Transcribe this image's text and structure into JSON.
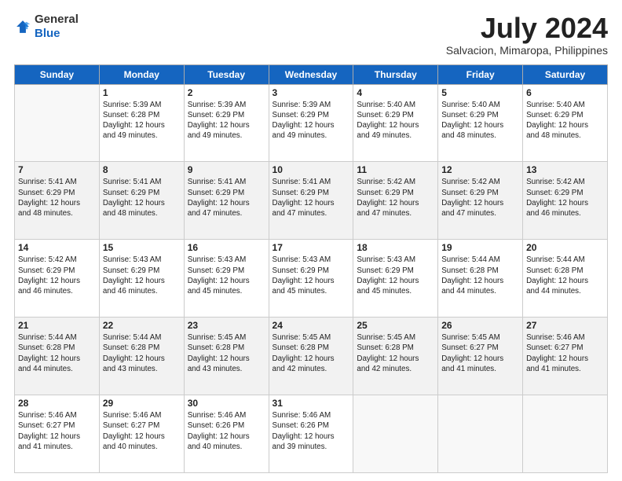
{
  "logo": {
    "general": "General",
    "blue": "Blue"
  },
  "header": {
    "month": "July 2024",
    "location": "Salvacion, Mimaropa, Philippines"
  },
  "weekdays": [
    "Sunday",
    "Monday",
    "Tuesday",
    "Wednesday",
    "Thursday",
    "Friday",
    "Saturday"
  ],
  "weeks": [
    [
      {
        "day": "",
        "info": ""
      },
      {
        "day": "1",
        "info": "Sunrise: 5:39 AM\nSunset: 6:28 PM\nDaylight: 12 hours\nand 49 minutes."
      },
      {
        "day": "2",
        "info": "Sunrise: 5:39 AM\nSunset: 6:29 PM\nDaylight: 12 hours\nand 49 minutes."
      },
      {
        "day": "3",
        "info": "Sunrise: 5:39 AM\nSunset: 6:29 PM\nDaylight: 12 hours\nand 49 minutes."
      },
      {
        "day": "4",
        "info": "Sunrise: 5:40 AM\nSunset: 6:29 PM\nDaylight: 12 hours\nand 49 minutes."
      },
      {
        "day": "5",
        "info": "Sunrise: 5:40 AM\nSunset: 6:29 PM\nDaylight: 12 hours\nand 48 minutes."
      },
      {
        "day": "6",
        "info": "Sunrise: 5:40 AM\nSunset: 6:29 PM\nDaylight: 12 hours\nand 48 minutes."
      }
    ],
    [
      {
        "day": "7",
        "info": "Sunrise: 5:41 AM\nSunset: 6:29 PM\nDaylight: 12 hours\nand 48 minutes."
      },
      {
        "day": "8",
        "info": "Sunrise: 5:41 AM\nSunset: 6:29 PM\nDaylight: 12 hours\nand 48 minutes."
      },
      {
        "day": "9",
        "info": "Sunrise: 5:41 AM\nSunset: 6:29 PM\nDaylight: 12 hours\nand 47 minutes."
      },
      {
        "day": "10",
        "info": "Sunrise: 5:41 AM\nSunset: 6:29 PM\nDaylight: 12 hours\nand 47 minutes."
      },
      {
        "day": "11",
        "info": "Sunrise: 5:42 AM\nSunset: 6:29 PM\nDaylight: 12 hours\nand 47 minutes."
      },
      {
        "day": "12",
        "info": "Sunrise: 5:42 AM\nSunset: 6:29 PM\nDaylight: 12 hours\nand 47 minutes."
      },
      {
        "day": "13",
        "info": "Sunrise: 5:42 AM\nSunset: 6:29 PM\nDaylight: 12 hours\nand 46 minutes."
      }
    ],
    [
      {
        "day": "14",
        "info": "Sunrise: 5:42 AM\nSunset: 6:29 PM\nDaylight: 12 hours\nand 46 minutes."
      },
      {
        "day": "15",
        "info": "Sunrise: 5:43 AM\nSunset: 6:29 PM\nDaylight: 12 hours\nand 46 minutes."
      },
      {
        "day": "16",
        "info": "Sunrise: 5:43 AM\nSunset: 6:29 PM\nDaylight: 12 hours\nand 45 minutes."
      },
      {
        "day": "17",
        "info": "Sunrise: 5:43 AM\nSunset: 6:29 PM\nDaylight: 12 hours\nand 45 minutes."
      },
      {
        "day": "18",
        "info": "Sunrise: 5:43 AM\nSunset: 6:29 PM\nDaylight: 12 hours\nand 45 minutes."
      },
      {
        "day": "19",
        "info": "Sunrise: 5:44 AM\nSunset: 6:28 PM\nDaylight: 12 hours\nand 44 minutes."
      },
      {
        "day": "20",
        "info": "Sunrise: 5:44 AM\nSunset: 6:28 PM\nDaylight: 12 hours\nand 44 minutes."
      }
    ],
    [
      {
        "day": "21",
        "info": "Sunrise: 5:44 AM\nSunset: 6:28 PM\nDaylight: 12 hours\nand 44 minutes."
      },
      {
        "day": "22",
        "info": "Sunrise: 5:44 AM\nSunset: 6:28 PM\nDaylight: 12 hours\nand 43 minutes."
      },
      {
        "day": "23",
        "info": "Sunrise: 5:45 AM\nSunset: 6:28 PM\nDaylight: 12 hours\nand 43 minutes."
      },
      {
        "day": "24",
        "info": "Sunrise: 5:45 AM\nSunset: 6:28 PM\nDaylight: 12 hours\nand 42 minutes."
      },
      {
        "day": "25",
        "info": "Sunrise: 5:45 AM\nSunset: 6:28 PM\nDaylight: 12 hours\nand 42 minutes."
      },
      {
        "day": "26",
        "info": "Sunrise: 5:45 AM\nSunset: 6:27 PM\nDaylight: 12 hours\nand 41 minutes."
      },
      {
        "day": "27",
        "info": "Sunrise: 5:46 AM\nSunset: 6:27 PM\nDaylight: 12 hours\nand 41 minutes."
      }
    ],
    [
      {
        "day": "28",
        "info": "Sunrise: 5:46 AM\nSunset: 6:27 PM\nDaylight: 12 hours\nand 41 minutes."
      },
      {
        "day": "29",
        "info": "Sunrise: 5:46 AM\nSunset: 6:27 PM\nDaylight: 12 hours\nand 40 minutes."
      },
      {
        "day": "30",
        "info": "Sunrise: 5:46 AM\nSunset: 6:26 PM\nDaylight: 12 hours\nand 40 minutes."
      },
      {
        "day": "31",
        "info": "Sunrise: 5:46 AM\nSunset: 6:26 PM\nDaylight: 12 hours\nand 39 minutes."
      },
      {
        "day": "",
        "info": ""
      },
      {
        "day": "",
        "info": ""
      },
      {
        "day": "",
        "info": ""
      }
    ]
  ]
}
